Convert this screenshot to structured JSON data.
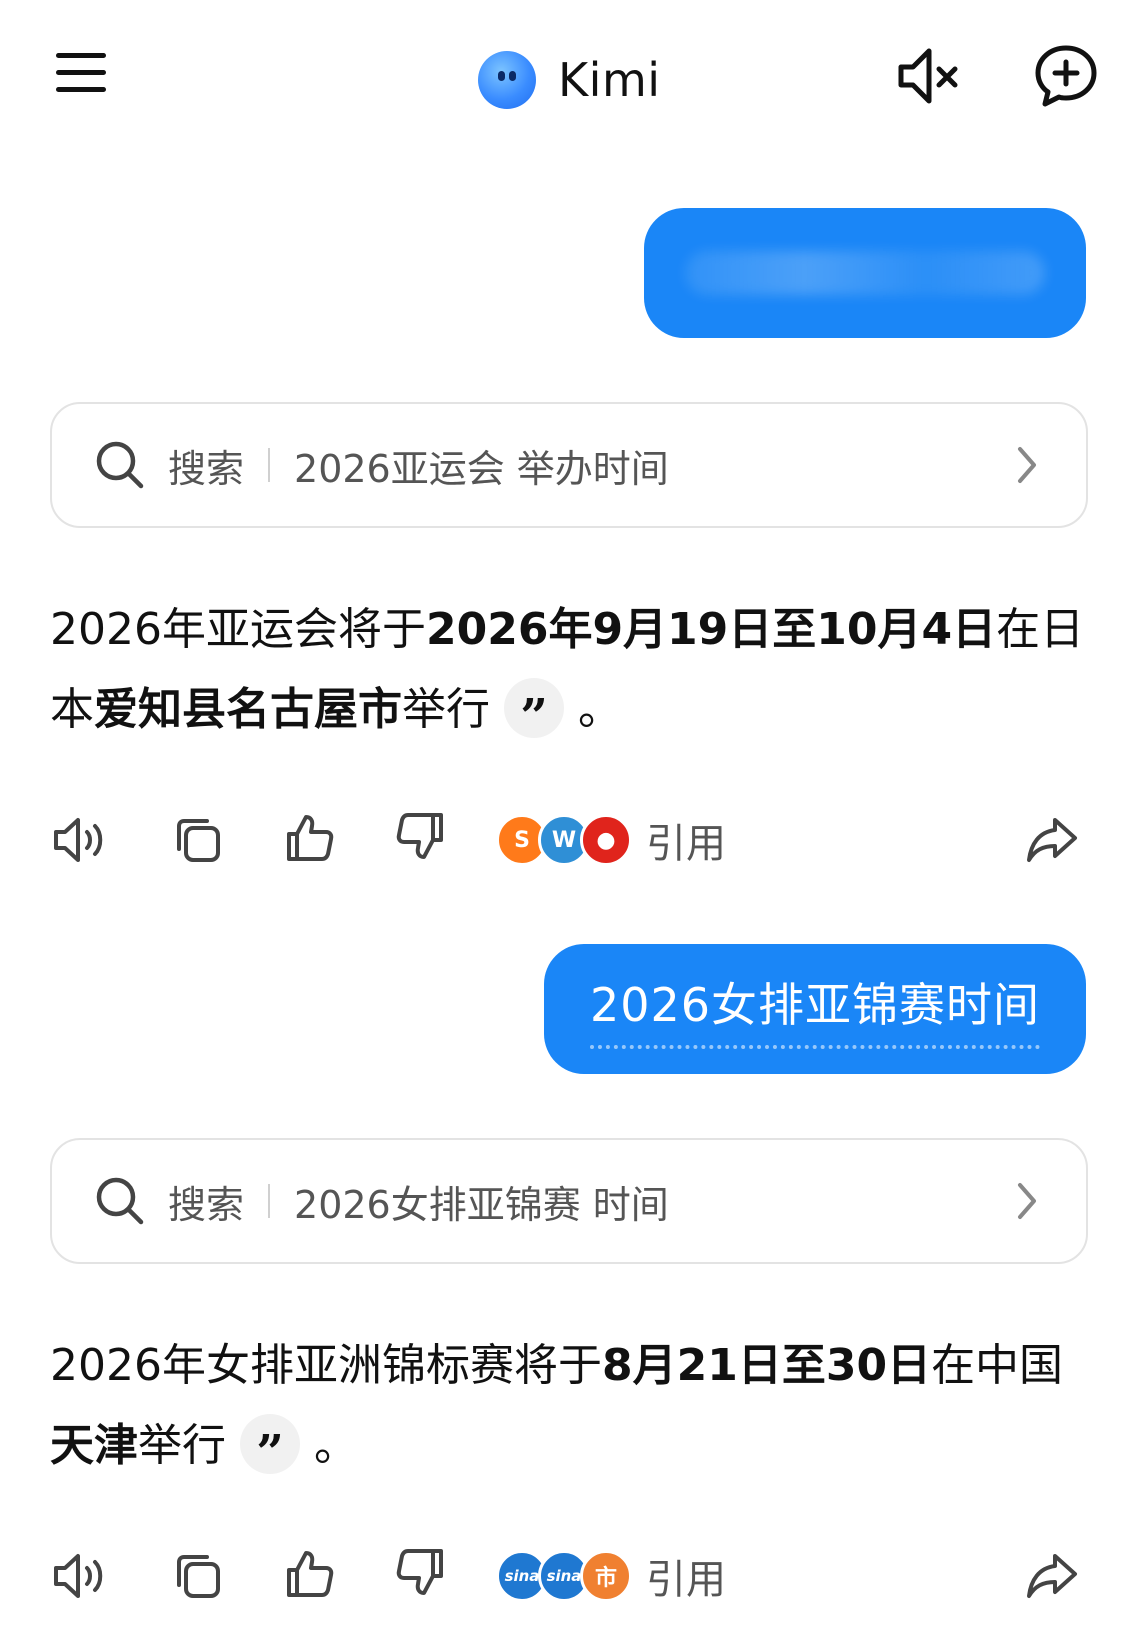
{
  "header": {
    "title": "Kimi",
    "icons": {
      "menu": "hamburger-menu-icon",
      "mute": "speaker-mute-icon",
      "new_chat": "new-chat-icon"
    }
  },
  "theme": {
    "accent": "#1a86f7",
    "text": "#111111",
    "muted": "#555555",
    "border": "#e3e3e3"
  },
  "conversation": [
    {
      "user": {
        "text": "",
        "blurred": true
      },
      "search": {
        "label": "搜索",
        "query": "2026亚运会 举办时间"
      },
      "answer": {
        "segments": [
          {
            "text": "2026年亚运会将于",
            "bold": false
          },
          {
            "text": "2026年9月19日至10月4日",
            "bold": true
          },
          {
            "text": "在日本",
            "bold": false
          },
          {
            "text": "爱知县名古屋市",
            "bold": true
          },
          {
            "text": "举行",
            "bold": false
          }
        ],
        "end": "。",
        "quote_glyph": "”"
      },
      "actions": {
        "cite_label": "引用",
        "sources": [
          {
            "icon": "sohu-icon",
            "glyph": "S",
            "color": "#ff7a1a"
          },
          {
            "icon": "waterfront-icon",
            "glyph": "W",
            "color": "#2f8fd6"
          },
          {
            "icon": "red-ball-icon",
            "glyph": "●",
            "color": "#e0241c"
          }
        ]
      }
    },
    {
      "user": {
        "text": "2026女排亚锦赛时间",
        "blurred": false
      },
      "search": {
        "label": "搜索",
        "query": "2026女排亚锦赛 时间"
      },
      "answer": {
        "segments": [
          {
            "text": "2026年女排亚洲锦标赛将于",
            "bold": false
          },
          {
            "text": "8月21日至30日",
            "bold": true
          },
          {
            "text": "在中国",
            "bold": false
          },
          {
            "text": "天津",
            "bold": true
          },
          {
            "text": "举行",
            "bold": false
          }
        ],
        "end": "。",
        "quote_glyph": "”"
      },
      "actions": {
        "cite_label": "引用",
        "sources": [
          {
            "icon": "sina-icon",
            "glyph": "sina",
            "color": "#1f78d1"
          },
          {
            "icon": "sina-icon",
            "glyph": "sina",
            "color": "#1f78d1"
          },
          {
            "icon": "local-news-icon",
            "glyph": "市",
            "color": "#f08030"
          }
        ]
      }
    }
  ]
}
